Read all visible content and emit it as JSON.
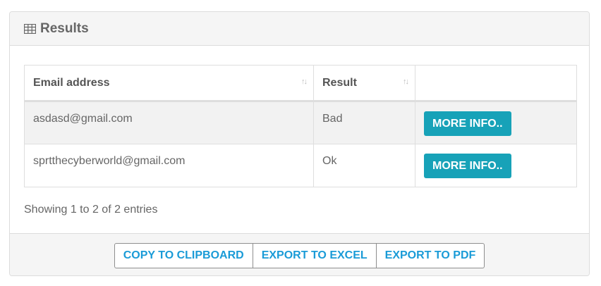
{
  "panel": {
    "title": "Results",
    "icon": "table-icon"
  },
  "table": {
    "columns": [
      "Email address",
      "Result",
      ""
    ],
    "rows": [
      {
        "email": "asdasd@gmail.com",
        "result": "Bad",
        "action": "MORE INFO.."
      },
      {
        "email": "sprtthecyberworld@gmail.com",
        "result": "Ok",
        "action": "MORE INFO.."
      }
    ]
  },
  "info": "Showing 1 to 2 of 2 entries",
  "footer": {
    "buttons": [
      "COPY TO CLIPBOARD",
      "EXPORT TO EXCEL",
      "EXPORT TO PDF"
    ]
  },
  "colors": {
    "accent": "#17a2b8",
    "link": "#1a9bd7"
  }
}
